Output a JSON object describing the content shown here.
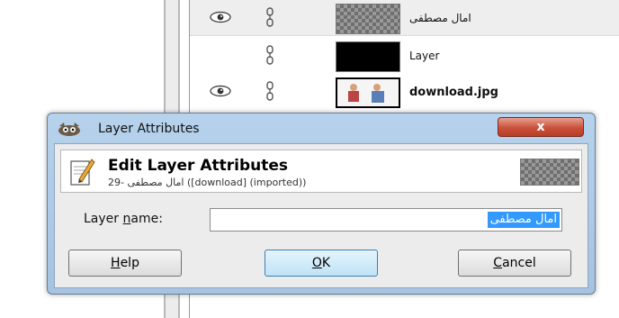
{
  "layers": [
    {
      "name": "امال مصطفى",
      "visible": true,
      "thumbnail": "checker",
      "selected": true
    },
    {
      "name": "Layer",
      "visible": false,
      "thumbnail": "black",
      "selected": false
    },
    {
      "name": "download.jpg",
      "visible": true,
      "thumbnail": "photo",
      "selected": false
    }
  ],
  "dialog": {
    "title": "Layer Attributes",
    "close_label": "x",
    "header_title": "Edit Layer Attributes",
    "header_subtitle": "امال مصطفى -29 ([download] (imported))",
    "name_label_prefix": "Layer ",
    "name_label_mnemonic": "n",
    "name_label_suffix": "ame:",
    "name_value": "امال مصطفى",
    "buttons": {
      "help": {
        "mnemonic": "H",
        "rest": "elp"
      },
      "ok": {
        "mnemonic": "O",
        "rest": "K"
      },
      "cancel": {
        "mnemonic": "C",
        "rest": "ancel"
      }
    }
  },
  "icons": {
    "eye": "eye-icon",
    "chain": "chain-icon",
    "title": "gimp-wilber-icon",
    "edit": "edit-pencil-icon"
  }
}
